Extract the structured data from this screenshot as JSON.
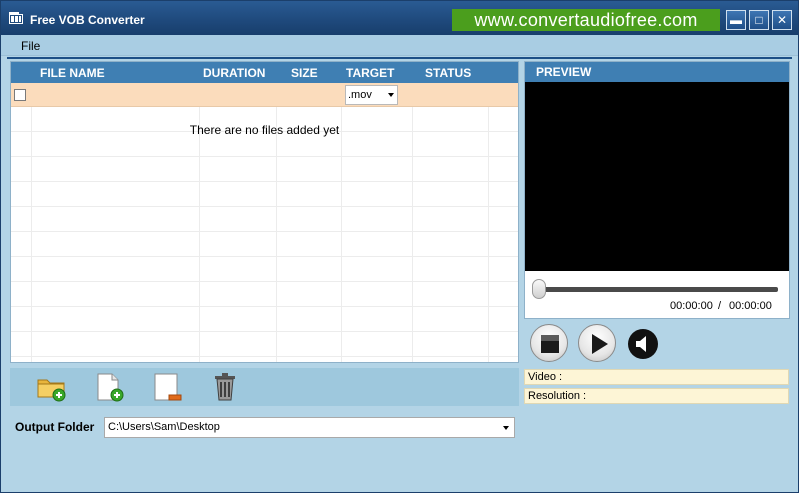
{
  "window": {
    "title": "Free VOB Converter",
    "promo_text": "www.convertaudiofree.com",
    "minimize_glyph": "▬",
    "maximize_glyph": "□",
    "close_glyph": "✕"
  },
  "menu": {
    "file_label": "File"
  },
  "file_list": {
    "columns": [
      "FILE NAME",
      "DURATION",
      "SIZE",
      "TARGET",
      "STATUS"
    ],
    "target_selected": ".mov",
    "empty_message": "There are no files added yet"
  },
  "toolbar": {
    "icons": [
      "add-folder-icon",
      "add-file-icon",
      "remove-file-icon",
      "trash-icon"
    ]
  },
  "output": {
    "label": "Output Folder",
    "path": "C:\\Users\\Sam\\Desktop"
  },
  "preview": {
    "header": "PREVIEW",
    "time_current": "00:00:00",
    "time_separator": "/",
    "time_total": "00:00:00",
    "progress": 0
  },
  "info": {
    "video_label": "Video :",
    "resolution_label": "Resolution :"
  },
  "colors": {
    "titlebar": "#1f4a7d",
    "promo_bg": "#4b9e1d",
    "header_blue": "#3f7fb3",
    "filter_row": "#fbdcbc",
    "window_bg": "#b3d4e6"
  }
}
